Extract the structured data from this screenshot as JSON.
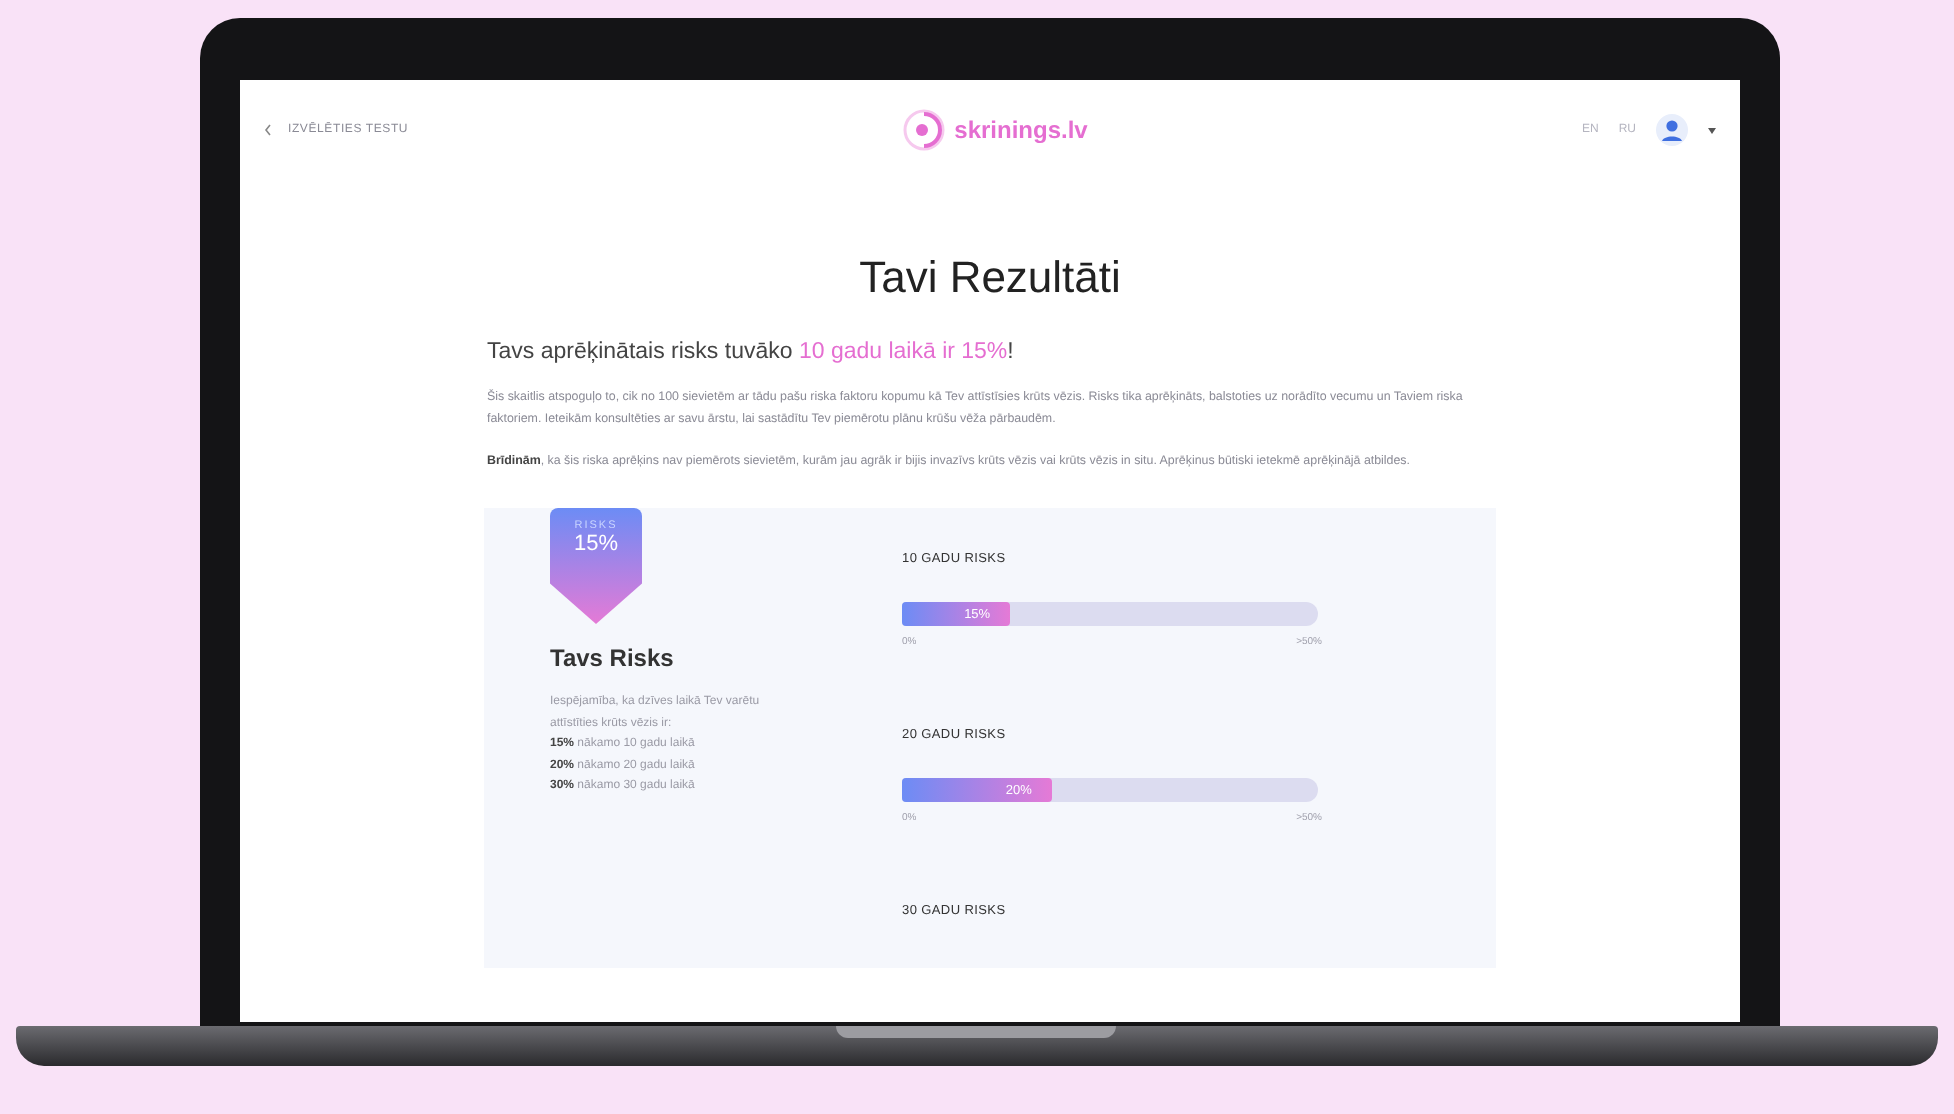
{
  "header": {
    "back_link": "IZVĒLĒTIES TESTU",
    "logo_text": "skrinings.lv",
    "languages": [
      "EN",
      "RU"
    ]
  },
  "title": "Tavi Rezultāti",
  "headline": "Tavs aprēķinātais risks tuvāko **10 gadu laikā ir 15%**!",
  "paragraphs": [
    "Šis skaitlis atspoguļo to, cik no 100 sievietēm ar tādu pašu riska faktoru kopumu kā Tev attīstīsies krūts vēzis. Risks tika aprēķināts, balstoties uz norādīto vecumu un Taviem riska faktoriem. Ieteikām konsultēties ar savu ārstu, lai sastādītu Tev piemērotu plānu krūšu vēža pārbaudēm.",
    "**Brīdinām**, ka šis riska aprēķins nav piemērots sievietēm, kurām jau agrāk ir bijis invazīvs krūts vēzis vai krūts vēzis in situ. Aprēķinus būtiski ietekmē aprēķinājā atbildes."
  ],
  "card": {
    "badge": {
      "label": "RISKS",
      "value": "15%"
    },
    "heading": "Tavs Risks",
    "intro": "Iespējamība, ka dzīves laikā Tev varētu attīstīties krūts vēzis ir:",
    "lines": [
      "**15%** nākamo 10 gadu laikā",
      "**20%** nākamo 20 gadu laikā",
      "**30%** nākamo 30 gadu laikā"
    ],
    "bars": [
      {
        "title": "10 GADU RISKS",
        "value_label": "15%",
        "level": 0.26,
        "min_label": "0%",
        "max_label": ">50%"
      },
      {
        "title": "20 GADU RISKS",
        "value_label": "20%",
        "level": 0.36,
        "min_label": "0%",
        "max_label": ">50%"
      },
      {
        "title": "30 GADU RISKS"
      }
    ]
  }
}
